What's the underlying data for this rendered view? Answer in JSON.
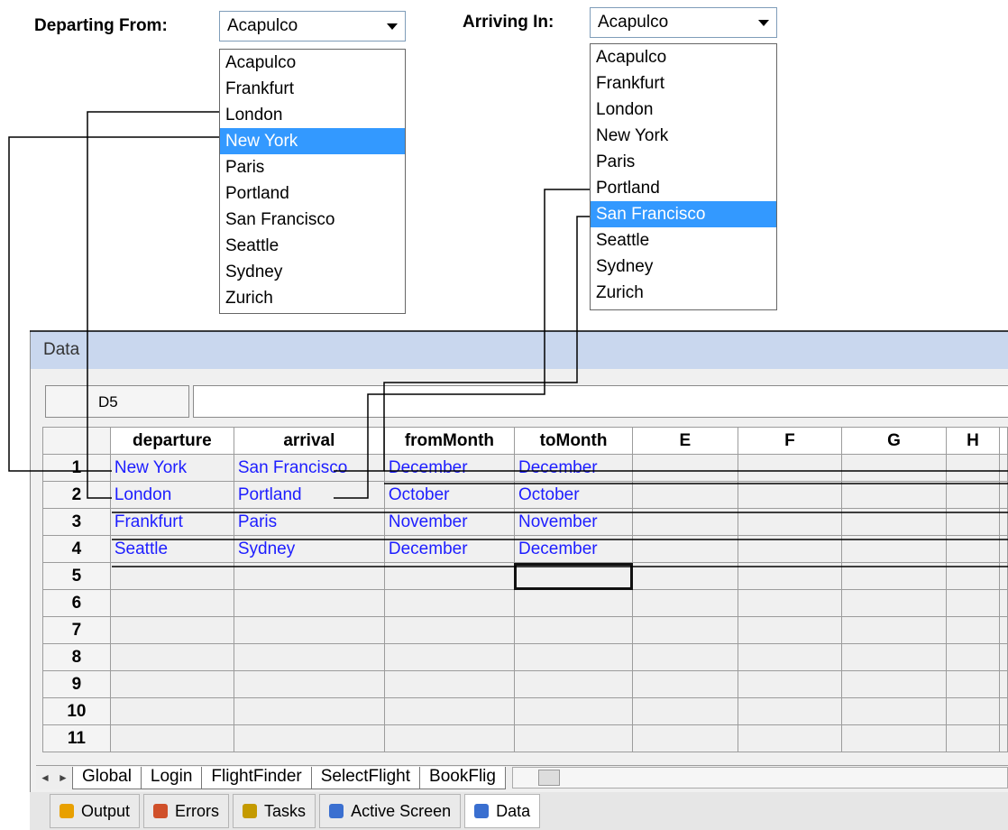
{
  "departing": {
    "label": "Departing From:",
    "value": "Acapulco",
    "options": [
      "Acapulco",
      "Frankfurt",
      "London",
      "New York",
      "Paris",
      "Portland",
      "San Francisco",
      "Seattle",
      "Sydney",
      "Zurich"
    ],
    "selected_index": 3
  },
  "arriving": {
    "label": "Arriving In:",
    "value": "Acapulco",
    "options": [
      "Acapulco",
      "Frankfurt",
      "London",
      "New York",
      "Paris",
      "Portland",
      "San Francisco",
      "Seattle",
      "Sydney",
      "Zurich"
    ],
    "selected_index": 6
  },
  "panel": {
    "title": "Data",
    "name_box": "D5",
    "formula": ""
  },
  "grid": {
    "columns": [
      "departure",
      "arrival",
      "fromMonth",
      "toMonth",
      "E",
      "F",
      "G",
      "H"
    ],
    "rows": [
      {
        "num": "1",
        "cells": [
          "New York",
          "San Francisco",
          "December",
          "December",
          "",
          "",
          "",
          ""
        ]
      },
      {
        "num": "2",
        "cells": [
          "London",
          "Portland",
          "October",
          "October",
          "",
          "",
          "",
          ""
        ]
      },
      {
        "num": "3",
        "cells": [
          "Frankfurt",
          "Paris",
          "November",
          "November",
          "",
          "",
          "",
          ""
        ]
      },
      {
        "num": "4",
        "cells": [
          "Seattle",
          "Sydney",
          "December",
          "December",
          "",
          "",
          "",
          ""
        ]
      },
      {
        "num": "5",
        "cells": [
          "",
          "",
          "",
          "",
          "",
          "",
          "",
          ""
        ]
      },
      {
        "num": "6",
        "cells": [
          "",
          "",
          "",
          "",
          "",
          "",
          "",
          ""
        ]
      },
      {
        "num": "7",
        "cells": [
          "",
          "",
          "",
          "",
          "",
          "",
          "",
          ""
        ]
      },
      {
        "num": "8",
        "cells": [
          "",
          "",
          "",
          "",
          "",
          "",
          "",
          ""
        ]
      },
      {
        "num": "9",
        "cells": [
          "",
          "",
          "",
          "",
          "",
          "",
          "",
          ""
        ]
      },
      {
        "num": "10",
        "cells": [
          "",
          "",
          "",
          "",
          "",
          "",
          "",
          ""
        ]
      },
      {
        "num": "11",
        "cells": [
          "",
          "",
          "",
          "",
          "",
          "",
          "",
          ""
        ]
      }
    ],
    "active_cell": "D5"
  },
  "sheet_tabs": [
    "Global",
    "Login",
    "FlightFinder",
    "SelectFlight",
    "BookFlig"
  ],
  "active_sheet": "FlightFinder",
  "bottom_tabs": [
    {
      "label": "Output",
      "icon": "output-icon"
    },
    {
      "label": "Errors",
      "icon": "errors-icon"
    },
    {
      "label": "Tasks",
      "icon": "tasks-icon"
    },
    {
      "label": "Active Screen",
      "icon": "active-screen-icon"
    },
    {
      "label": "Data",
      "icon": "data-icon"
    }
  ],
  "active_bottom_tab": "Data",
  "colors": {
    "selection": "#3399ff",
    "cell_text": "#1d1dff",
    "panel_header": "#c9d7ee"
  }
}
